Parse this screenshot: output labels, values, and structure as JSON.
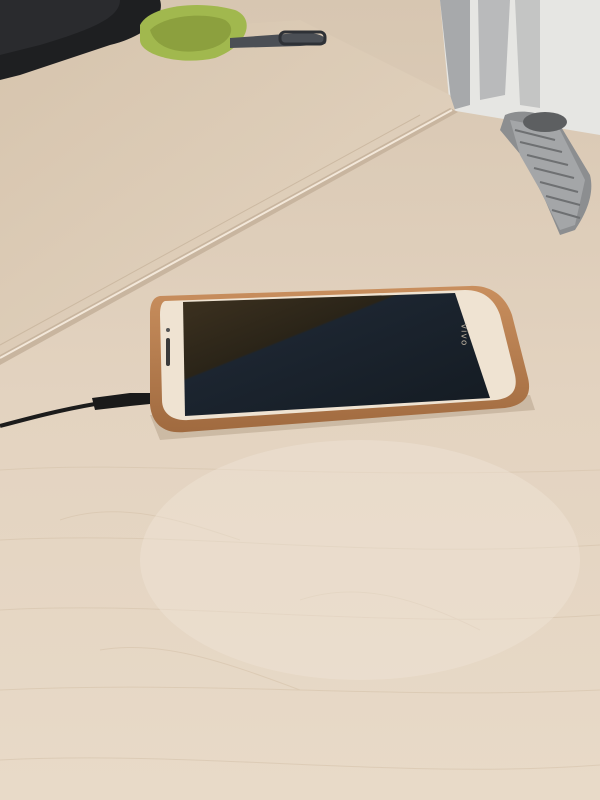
{
  "scene": {
    "description_colors": {
      "desk": "#e2d2bf",
      "desk_shadow": "#cdbba5",
      "wall": "#e9e9e6",
      "phone_case": "#b57a4d",
      "phone_body": "#f0e6d8",
      "screen": "#1a2228",
      "cable": "#1c1c1c",
      "watch": "#8a8c8e",
      "bag_strap": "#9bb54a"
    },
    "phone": {
      "brand": "vivo"
    }
  }
}
